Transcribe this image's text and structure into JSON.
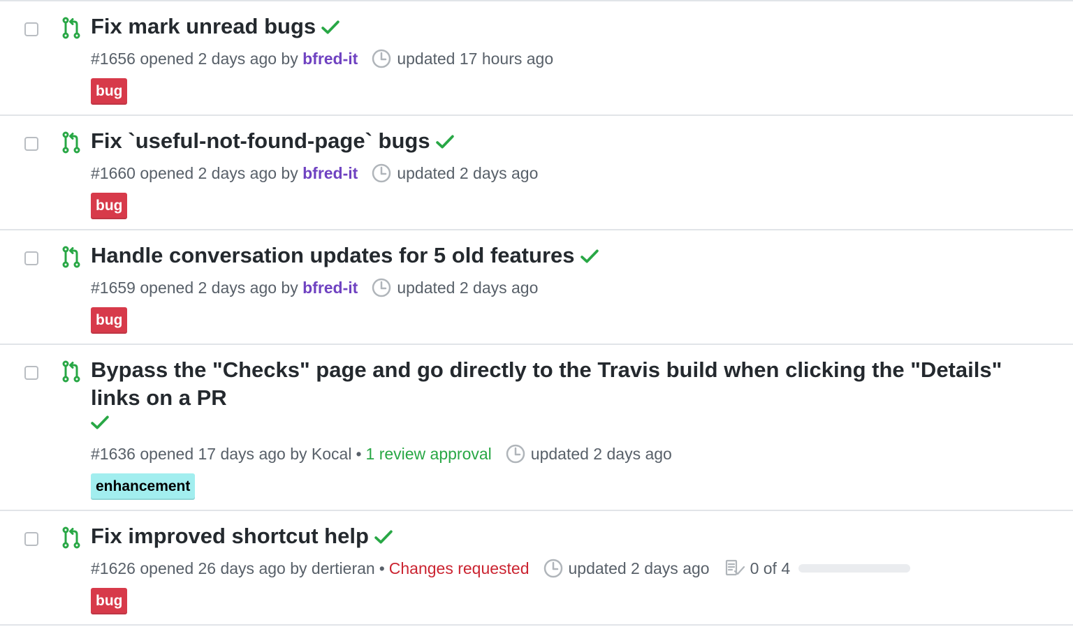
{
  "colors": {
    "bug_label": "#d73a4a",
    "bug_label_text": "#ffffff",
    "enhancement_label": "#a2eeef",
    "enhancement_label_text": "#000000",
    "check": "#28a745",
    "pr_open_icon": "#28a745",
    "author_link": "#6f42c1",
    "approval": "#28a745",
    "changes_requested": "#cb2431"
  },
  "icons": {
    "pr": "git-pull-request-icon",
    "check": "check-icon",
    "clock": "clock-icon",
    "tasks": "checklist-icon"
  },
  "prs": [
    {
      "title": "Fix mark unread bugs",
      "number": "#1656",
      "opened": "opened 2 days ago by",
      "author": "bfred-it",
      "updated": "updated 17 hours ago",
      "label": "bug"
    },
    {
      "title": "Fix `useful-not-found-page` bugs",
      "number": "#1660",
      "opened": "opened 2 days ago by",
      "author": "bfred-it",
      "updated": "updated 2 days ago",
      "label": "bug"
    },
    {
      "title": "Handle conversation updates for 5 old features",
      "number": "#1659",
      "opened": "opened 2 days ago by",
      "author": "bfred-it",
      "updated": "updated 2 days ago",
      "label": "bug"
    },
    {
      "title_line1": "Bypass the \"Checks\" page and go directly to the Travis build when clicking the \"Details\"",
      "title_line2": "links on a PR",
      "number": "#1636",
      "opened": "opened 17 days ago by",
      "author": "Kocal",
      "separator": "•",
      "review": "1 review approval",
      "updated": "updated 2 days ago",
      "label": "enhancement"
    },
    {
      "title": "Fix improved shortcut help",
      "number": "#1626",
      "opened": "opened 26 days ago by",
      "author": "dertieran",
      "separator": "•",
      "review": "Changes requested",
      "updated": "updated 2 days ago",
      "tasks": "0 of 4",
      "tasks_progress": 0,
      "label": "bug"
    }
  ]
}
